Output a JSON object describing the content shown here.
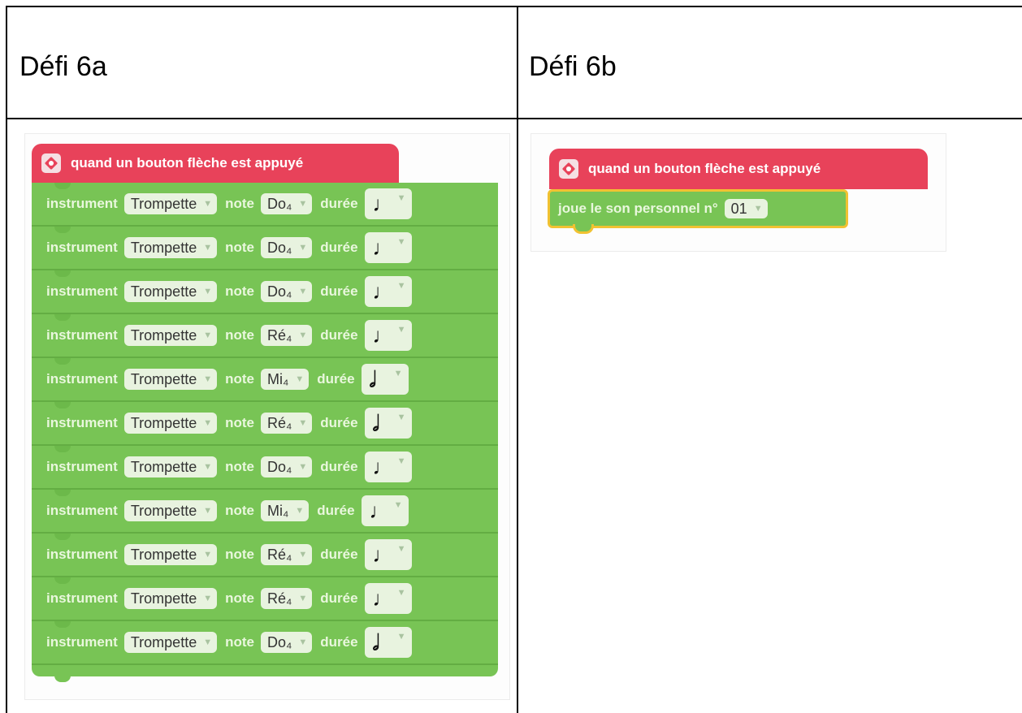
{
  "headers": {
    "left": "Défi 6a",
    "right": "Défi 6b"
  },
  "defi_a": {
    "hat_label": "quand un bouton flèche est appuyé",
    "field_labels": {
      "instrument": "instrument",
      "note": "note",
      "duree": "durée"
    },
    "rows": [
      {
        "instrument": "Trompette",
        "note": "Do₄",
        "duration_glyph": "♩"
      },
      {
        "instrument": "Trompette",
        "note": "Do₄",
        "duration_glyph": "♩"
      },
      {
        "instrument": "Trompette",
        "note": "Do₄",
        "duration_glyph": "♩"
      },
      {
        "instrument": "Trompette",
        "note": "Ré₄",
        "duration_glyph": "♩"
      },
      {
        "instrument": "Trompette",
        "note": "Mi₄",
        "duration_glyph": "𝅗𝅥"
      },
      {
        "instrument": "Trompette",
        "note": "Ré₄",
        "duration_glyph": "𝅗𝅥"
      },
      {
        "instrument": "Trompette",
        "note": "Do₄",
        "duration_glyph": "♩"
      },
      {
        "instrument": "Trompette",
        "note": "Mi₄",
        "duration_glyph": "♩"
      },
      {
        "instrument": "Trompette",
        "note": "Ré₄",
        "duration_glyph": "♩"
      },
      {
        "instrument": "Trompette",
        "note": "Ré₄",
        "duration_glyph": "♩"
      },
      {
        "instrument": "Trompette",
        "note": "Do₄",
        "duration_glyph": "𝅗𝅥"
      }
    ]
  },
  "defi_b": {
    "hat_label": "quand un bouton flèche est appuyé",
    "block_label": "joue le son personnel n°",
    "sound_number": "01"
  },
  "colors": {
    "event_block": "#e8425a",
    "sound_block": "#78c455",
    "selection_outline": "#f1c232"
  }
}
